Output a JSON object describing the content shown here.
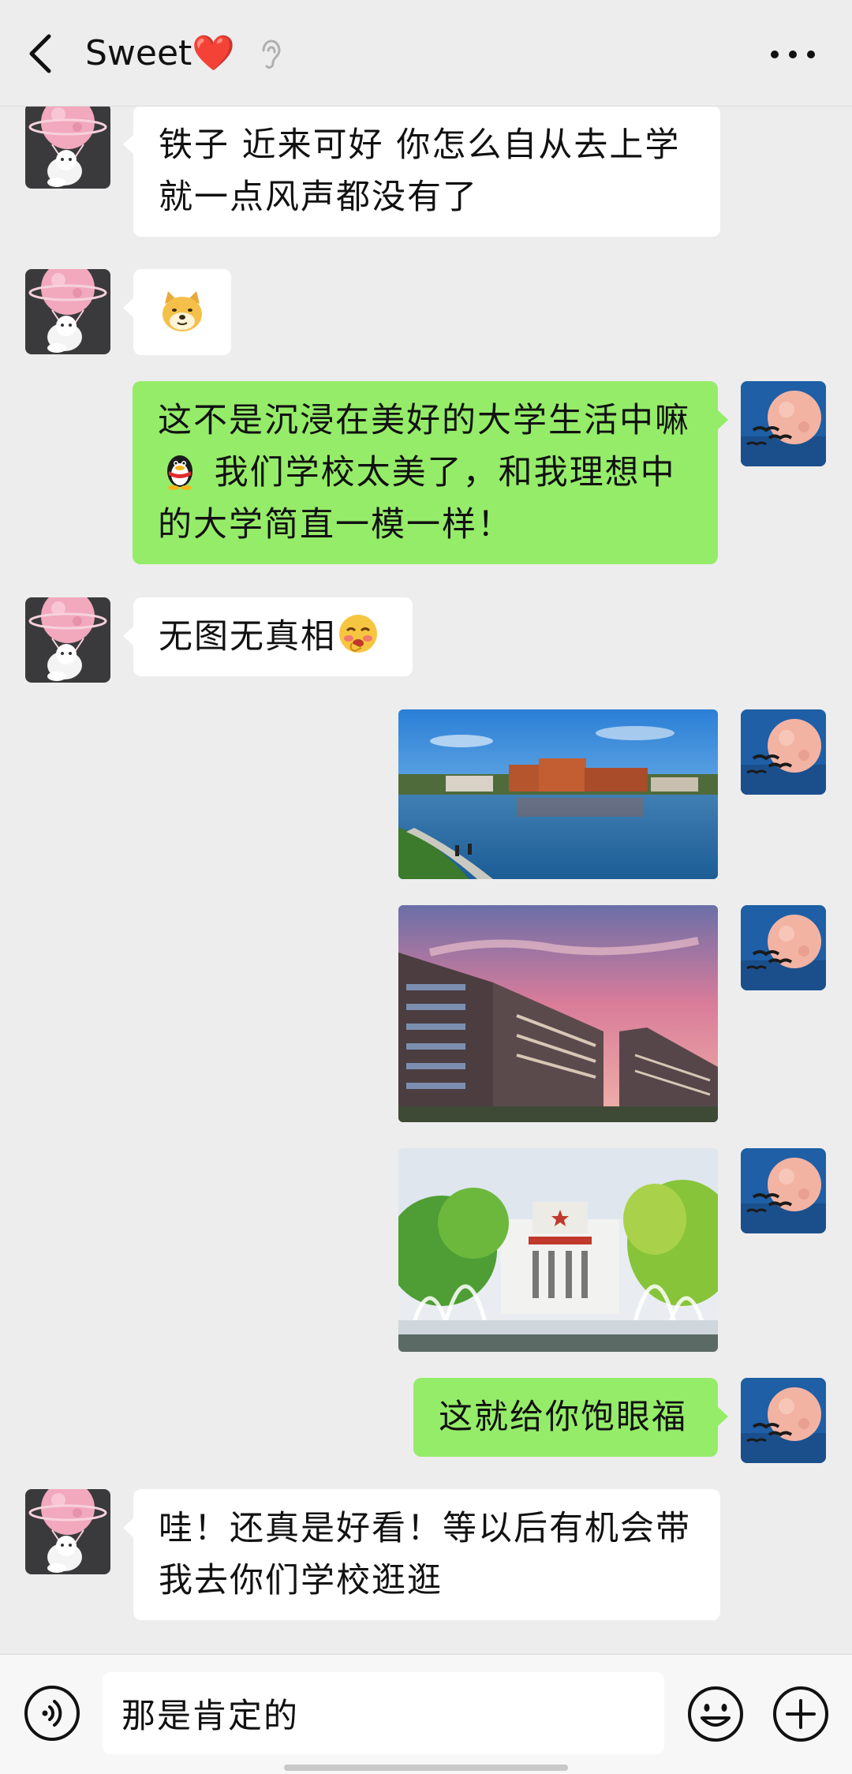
{
  "header": {
    "contact_name": "Sweet❤️",
    "back_icon": "chevron-left-icon",
    "status_icon": "ear-icon",
    "more_icon": "more-horizontal-icon"
  },
  "messages": [
    {
      "sender": "contact",
      "type": "text",
      "text_lines": [
        "铁子 近来可好 你怎么自从去上学",
        "就一点风声都没有了"
      ]
    },
    {
      "sender": "contact",
      "type": "sticker",
      "sticker": "doge-emoji"
    },
    {
      "sender": "me",
      "type": "text",
      "text_lines": [
        "这不是沉浸在美好的大学生活中嘛",
        "我们学校太美了，和我理想中",
        "的大学简直一模一样！"
      ],
      "emoji": "qq-penguin-emoji"
    },
    {
      "sender": "contact",
      "type": "text",
      "text": "无图无真相",
      "emoji": "blushing-emoji"
    },
    {
      "sender": "me",
      "type": "image",
      "image": "campus-lake-photo"
    },
    {
      "sender": "me",
      "type": "image",
      "image": "campus-building-sunset-photo"
    },
    {
      "sender": "me",
      "type": "image",
      "image": "campus-fountain-hall-photo"
    },
    {
      "sender": "me",
      "type": "text",
      "text": "这就给你饱眼福"
    },
    {
      "sender": "contact",
      "type": "text",
      "text_lines": [
        "哇！还真是好看！等以后有机会带",
        "我去你们学校逛逛"
      ]
    }
  ],
  "input": {
    "value": "那是肯定的",
    "voice_icon": "voice-icon",
    "emoji_icon": "emoji-icon",
    "plus_icon": "plus-icon"
  },
  "colors": {
    "background": "#ededed",
    "outgoing_bubble": "#95ec69",
    "incoming_bubble": "#ffffff"
  }
}
